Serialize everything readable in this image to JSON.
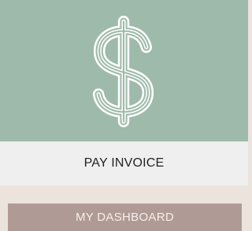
{
  "pay_invoice": {
    "label": "PAY INVOICE",
    "icon": "dollar-sign-icon",
    "colors": {
      "image_bg": "#9ebaaa",
      "label_bg": "#efefef",
      "icon_stroke": "#ffffff"
    }
  },
  "dashboard": {
    "label": "MY DASHBOARD",
    "colors": {
      "bg": "#b09a95",
      "text": "#f5efed"
    }
  }
}
